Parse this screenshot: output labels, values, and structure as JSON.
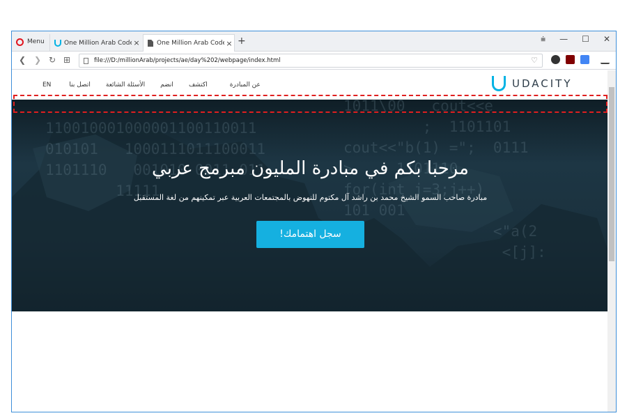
{
  "browser": {
    "menu_label": "Menu",
    "tabs": [
      {
        "title": "One Million Arab Coders",
        "close": "×"
      },
      {
        "title": "One Million Arab Coders",
        "close": "×"
      }
    ],
    "new_tab": "+",
    "controls": {
      "tabs_menu": "⩧",
      "minimize": "—",
      "maximize": "☐",
      "close": "✕"
    },
    "nav": {
      "back": "❮",
      "forward": "❯",
      "reload": "↻",
      "speed_dial": "⊞"
    },
    "url": "file:///D:/millionArab/projects/ae/day%202/webpage/index.html",
    "heart": "♡"
  },
  "site": {
    "logo_text": "UDACITY",
    "nav": [
      {
        "label": "EN"
      },
      {
        "label": "اتصل بنا"
      },
      {
        "label": "الأسئلة الشائعة"
      },
      {
        "label": "انضم"
      },
      {
        "label": "اكتشف"
      },
      {
        "label": "عن المبادرة"
      }
    ],
    "hero": {
      "title": "مرحبا بكم في مبادرة المليون مبرمج عربي",
      "subtitle": "مبادرة صاحب السمو الشيخ محمد بن راشد آل مكتوم للنهوض بالمجتمعات العربية عبر تمكينهم من لغة المستقبل",
      "cta": "سجل اهتمامك!"
    }
  },
  "colors": {
    "accent": "#15b0e0",
    "hero_bg": "#1c3340",
    "highlight_dash": "#e01f1f",
    "window_border": "#3d8fd9"
  }
}
